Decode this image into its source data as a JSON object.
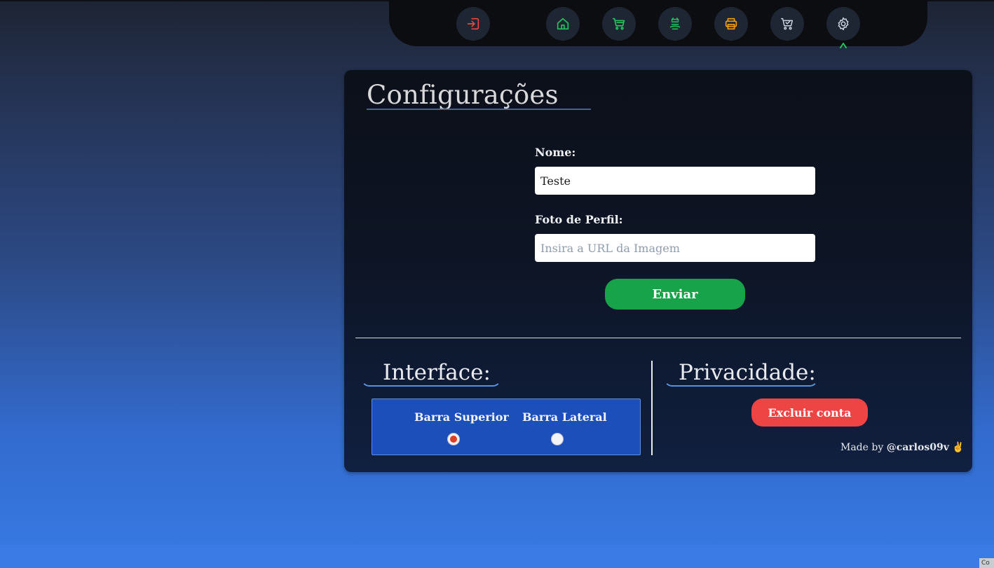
{
  "nav": {
    "items": [
      {
        "id": "logout",
        "icon": "logout-icon",
        "color": "#ef4444"
      },
      {
        "id": "home",
        "icon": "home-icon",
        "color": "#22c55e"
      },
      {
        "id": "cart",
        "icon": "cart-icon",
        "color": "#22c55e"
      },
      {
        "id": "money",
        "icon": "money-icon",
        "color": "#22c55e"
      },
      {
        "id": "print",
        "icon": "printer-icon",
        "color": "#f59e0b"
      },
      {
        "id": "cart-check",
        "icon": "cart-check-icon",
        "color": "#cbd5e1"
      },
      {
        "id": "settings",
        "icon": "gear-icon",
        "color": "#cbd5e1",
        "active": true
      }
    ],
    "active_indicator": "^",
    "indicator_color": "#22c55e"
  },
  "page": {
    "title": "Configurações"
  },
  "form": {
    "name_label": "Nome:",
    "name_value": "Teste",
    "photo_label": "Foto de Perfil:",
    "photo_placeholder": "Insira a URL da Imagem",
    "photo_value": "",
    "submit_label": "Enviar"
  },
  "interface": {
    "title": "Interface:",
    "options": [
      {
        "label": "Barra Superior",
        "selected": true
      },
      {
        "label": "Barra Lateral",
        "selected": false
      }
    ]
  },
  "privacy": {
    "title": "Privacidade:",
    "delete_label": "Excluir conta"
  },
  "footer": {
    "made_by": "Made by",
    "handle": "@carlos09v",
    "emoji": "✌"
  },
  "colors": {
    "accent_green": "#16a34a",
    "danger_red": "#ef4444",
    "selected_radio": "#e23b24"
  }
}
